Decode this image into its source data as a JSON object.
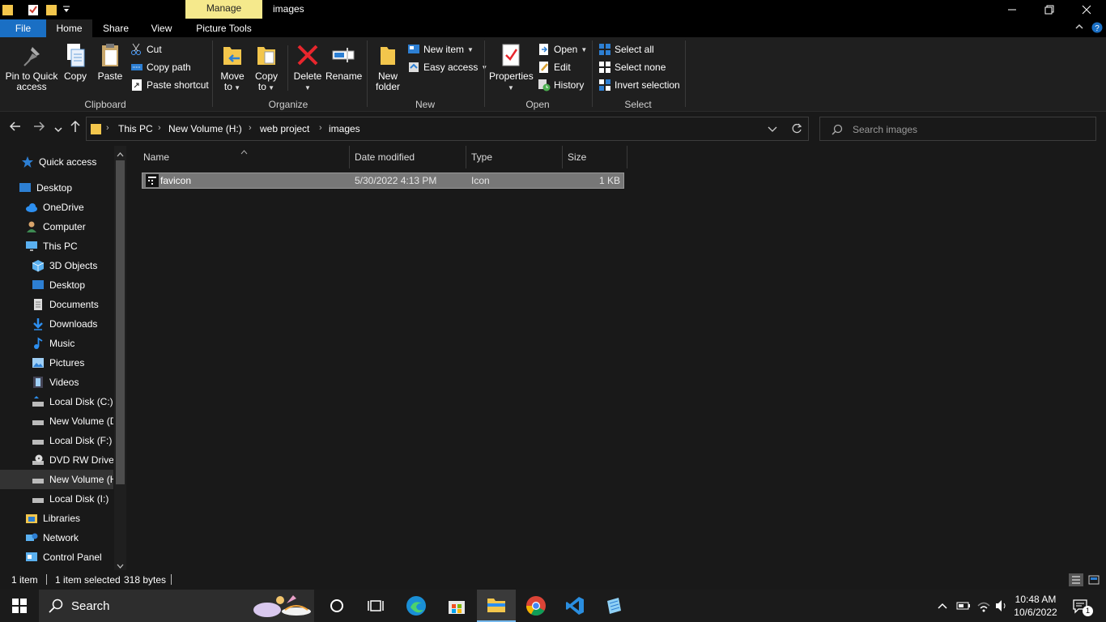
{
  "title_bar": {
    "context_tab": "Manage",
    "window_title": "images"
  },
  "ribbon_tabs": {
    "file": "File",
    "home": "Home",
    "share": "Share",
    "view": "View",
    "picture_tools": "Picture Tools"
  },
  "clipboard": {
    "pin": "Pin to Quick access",
    "pin_line1": "Pin to Quick",
    "pin_line2": "access",
    "copy": "Copy",
    "paste": "Paste",
    "cut": "Cut",
    "copy_path": "Copy path",
    "paste_shortcut": "Paste shortcut",
    "group": "Clipboard"
  },
  "organize": {
    "move_to_line1": "Move",
    "move_to_line2": "to",
    "copy_to_line1": "Copy",
    "copy_to_line2": "to",
    "delete": "Delete",
    "rename": "Rename",
    "group": "Organize"
  },
  "new_group": {
    "new_folder_line1": "New",
    "new_folder_line2": "folder",
    "new_item": "New item",
    "easy_access": "Easy access",
    "group": "New"
  },
  "open_group": {
    "properties": "Properties",
    "open": "Open",
    "edit": "Edit",
    "history": "History",
    "group": "Open"
  },
  "select_group": {
    "select_all": "Select all",
    "select_none": "Select none",
    "invert_selection": "Invert selection",
    "group": "Select"
  },
  "breadcrumb": [
    "This PC",
    "New Volume (H:)",
    "web project",
    "images"
  ],
  "search": {
    "placeholder": "Search images"
  },
  "nav": {
    "quick_access": "Quick access",
    "desktop": "Desktop",
    "onedrive": "OneDrive",
    "computer": "Computer",
    "this_pc": "This PC",
    "objects_3d": "3D Objects",
    "desktop_pc": "Desktop",
    "documents": "Documents",
    "downloads": "Downloads",
    "music": "Music",
    "pictures": "Pictures",
    "videos": "Videos",
    "local_c": "Local Disk (C:)",
    "new_volume_d": "New Volume (D",
    "local_f": "Local Disk (F:)",
    "dvd": "DVD RW Drive",
    "new_volume_h": "New Volume (H",
    "local_i": "Local Disk (I:)",
    "libraries": "Libraries",
    "network": "Network",
    "control_panel": "Control Panel"
  },
  "columns": {
    "name": "Name",
    "date_modified": "Date modified",
    "type": "Type",
    "size": "Size"
  },
  "files": [
    {
      "name": "favicon",
      "date_modified": "5/30/2022 4:13 PM",
      "type": "Icon",
      "size": "1 KB"
    }
  ],
  "status": {
    "count": "1 item",
    "selected": "1 item selected",
    "bytes": "318 bytes"
  },
  "taskbar": {
    "search_label": "Search",
    "time": "10:48 AM",
    "date": "10/6/2022",
    "notification_count": "1"
  },
  "colors": {
    "accent_file_tab": "#1a6fc4",
    "manage_tab": "#f5e98c",
    "background": "#191919"
  }
}
